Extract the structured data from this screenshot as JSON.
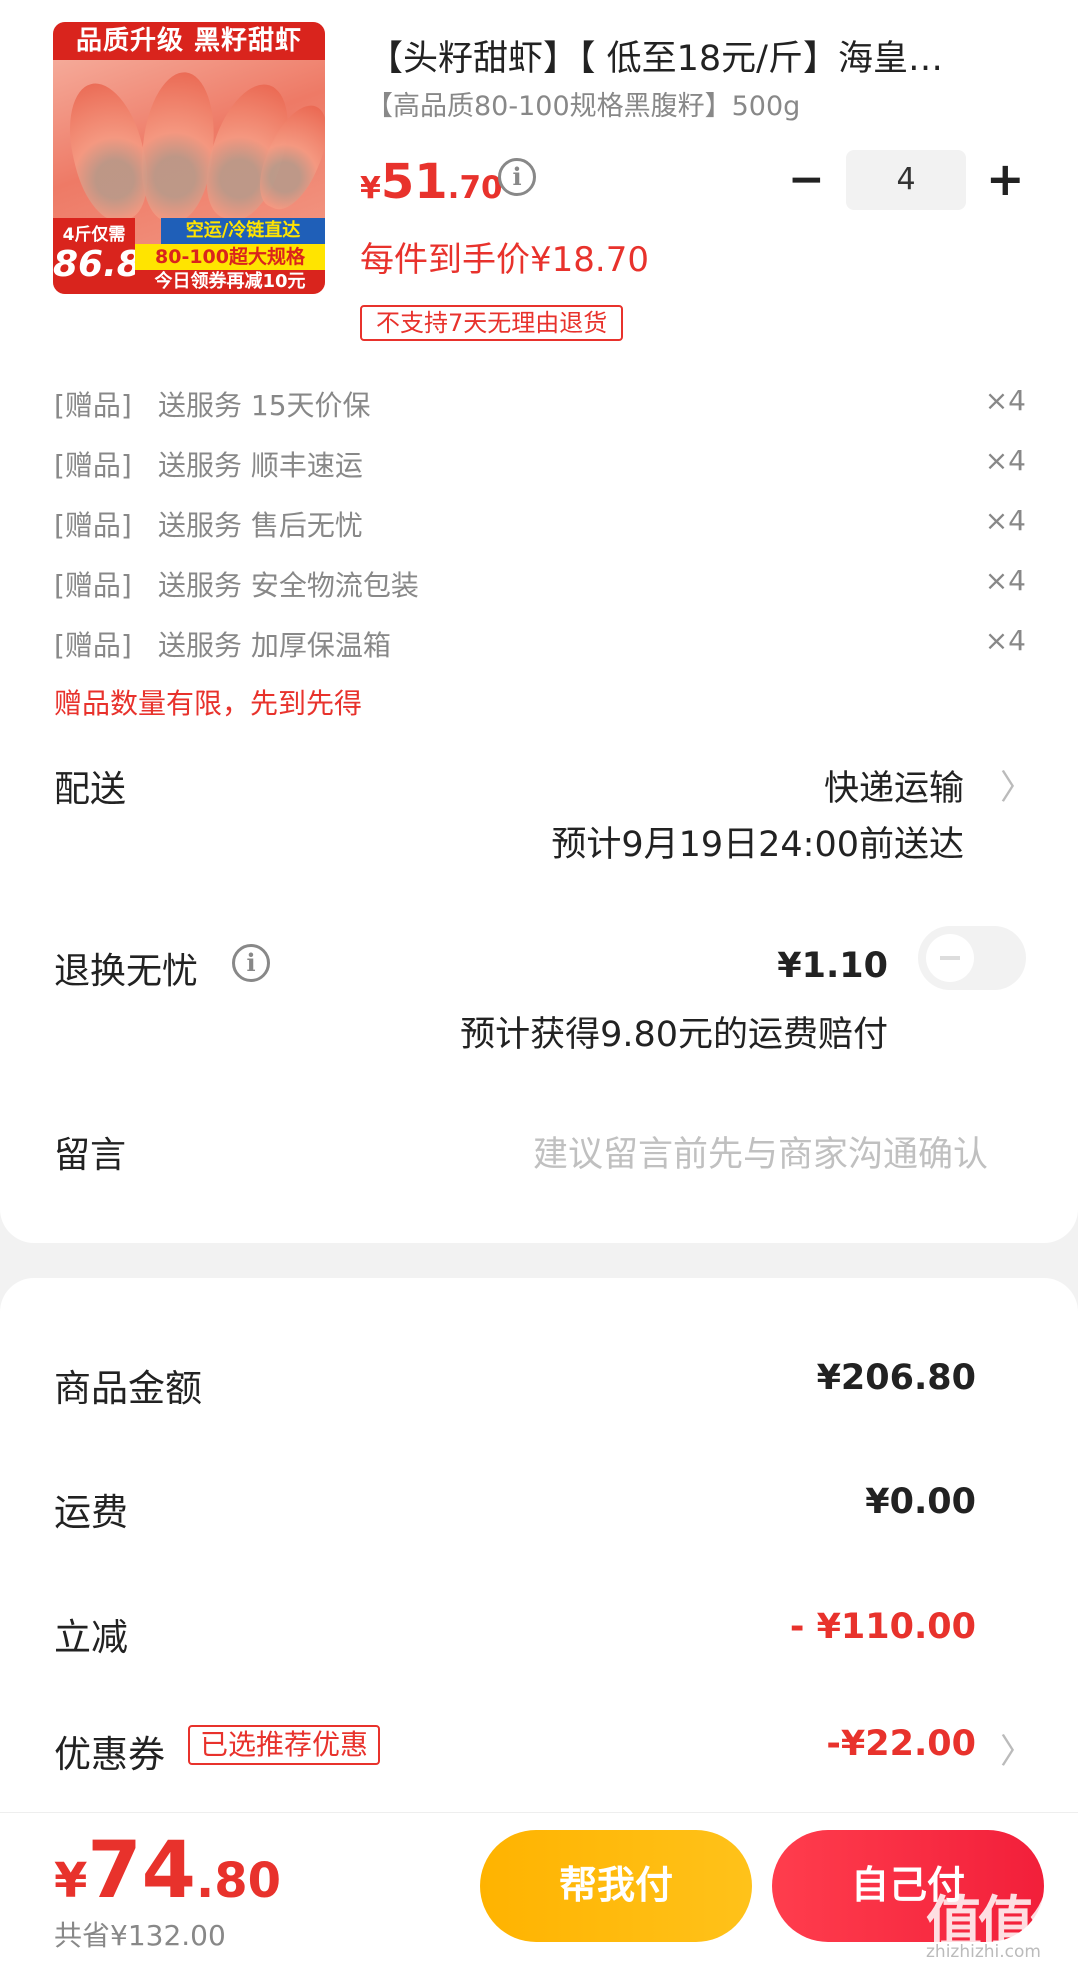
{
  "product": {
    "title": "【头籽甜虾】【 低至18元/斤】海皇…",
    "spec": "【高品质80-100规格黑腹籽】500g",
    "price_symbol": "¥",
    "price_int": "51",
    "price_dec": ".70",
    "unit_price": "每件到手价¥18.70",
    "no_return_tag": "不支持7天无理由退货",
    "quantity": "4",
    "image": {
      "banner_top": "品质升级 黑籽甜虾",
      "tag_small": "4斤仅需",
      "tag_price": "86.8",
      "stripe1": "空运/冷链直达",
      "stripe2": "80-100超大规格",
      "stripe3": "今日领券再减10元"
    }
  },
  "gifts": [
    {
      "tag": "[赠品]",
      "name": "送服务 15天价保",
      "qty": "×4"
    },
    {
      "tag": "[赠品]",
      "name": "送服务 顺丰速运",
      "qty": "×4"
    },
    {
      "tag": "[赠品]",
      "name": "送服务 售后无忧",
      "qty": "×4"
    },
    {
      "tag": "[赠品]",
      "name": "送服务 安全物流包装",
      "qty": "×4"
    },
    {
      "tag": "[赠品]",
      "name": "送服务 加厚保温箱",
      "qty": "×4"
    }
  ],
  "gift_note": "赠品数量有限，先到先得",
  "delivery": {
    "label": "配送",
    "method": "快递运输",
    "eta": "预计9月19日24:00前送达"
  },
  "return_service": {
    "label": "退换无忧",
    "price": "¥1.10",
    "desc": "预计获得9.80元的运费赔付"
  },
  "remark": {
    "label": "留言",
    "placeholder": "建议留言前先与商家沟通确认"
  },
  "summary": {
    "goods_label": "商品金额",
    "goods_value": "¥206.80",
    "shipping_label": "运费",
    "shipping_value": "¥0.00",
    "discount_label": "立减",
    "discount_value": "- ¥110.00",
    "coupon_label": "优惠券",
    "coupon_tag": "已选推荐优惠",
    "coupon_value": "-¥22.00"
  },
  "footer": {
    "total_symbol": "¥",
    "total_int": "74",
    "total_dec": ".80",
    "saved": "共省¥132.00",
    "help_pay": "帮我付",
    "self_pay": "自己付"
  },
  "watermark": {
    "text": "值值值",
    "sub": "zhizhizhi.com"
  },
  "colors": {
    "accent_red": "#e8322c",
    "help_button": "#ffb300",
    "self_button": "#f21f3a"
  }
}
